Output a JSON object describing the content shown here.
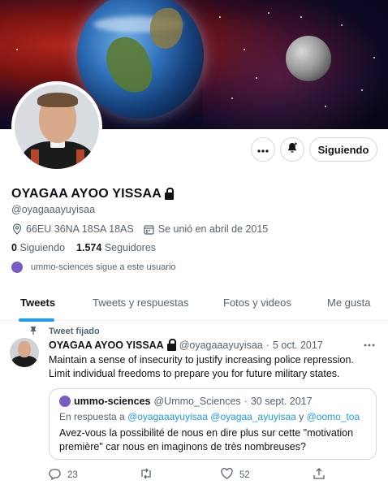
{
  "profile": {
    "name": "OYAGAA AYOO YISSAA",
    "handle": "@oyagaaayuyisaa",
    "location": "66EU 36NA 18SA 18AS",
    "joined": "Se unió en abril de 2015",
    "following_count": "0",
    "following_label": "Siguiendo",
    "followers_count": "1.574",
    "followers_label": "Seguidores",
    "followed_by": "ummo-sciences sigue a este usuario"
  },
  "header_actions": {
    "more_icon": "more-horizontal-icon",
    "notify_icon": "bell-plus-icon",
    "follow_button": "Siguiendo"
  },
  "tabs": [
    {
      "label": "Tweets",
      "active": true
    },
    {
      "label": "Tweets y respuestas",
      "active": false
    },
    {
      "label": "Fotos y videos",
      "active": false
    },
    {
      "label": "Me gusta",
      "active": false
    }
  ],
  "pinned_label": "Tweet fijado",
  "tweet": {
    "name": "OYAGAA AYOO YISSAA",
    "handle": "@oyagaaayuyisaa",
    "sep": "·",
    "date": "5 oct. 2017",
    "text": "Maintain a sense of insecurity to justify increasing police repression. Limit individual freedoms to prepare you for future military states.",
    "quote": {
      "name": "ummo-sciences",
      "handle": "@Ummo_Sciences",
      "sep": "·",
      "date": "30 sept. 2017",
      "reply_prefix": "En respuesta a",
      "reply_users": "@oyagaaayuyisaa @oyagaa_ayuyisaa",
      "reply_and": "y",
      "reply_last": "@oomo_toa",
      "text": "Avez-vous la possibilité de nous en dire plus sur cette \"motivation première\" car nous en imaginons de très nombreuses?"
    },
    "replies": "23",
    "likes": "52"
  },
  "colors": {
    "accent": "#1d9bf0",
    "secondary_text": "#536471",
    "border": "#cfd9de"
  }
}
